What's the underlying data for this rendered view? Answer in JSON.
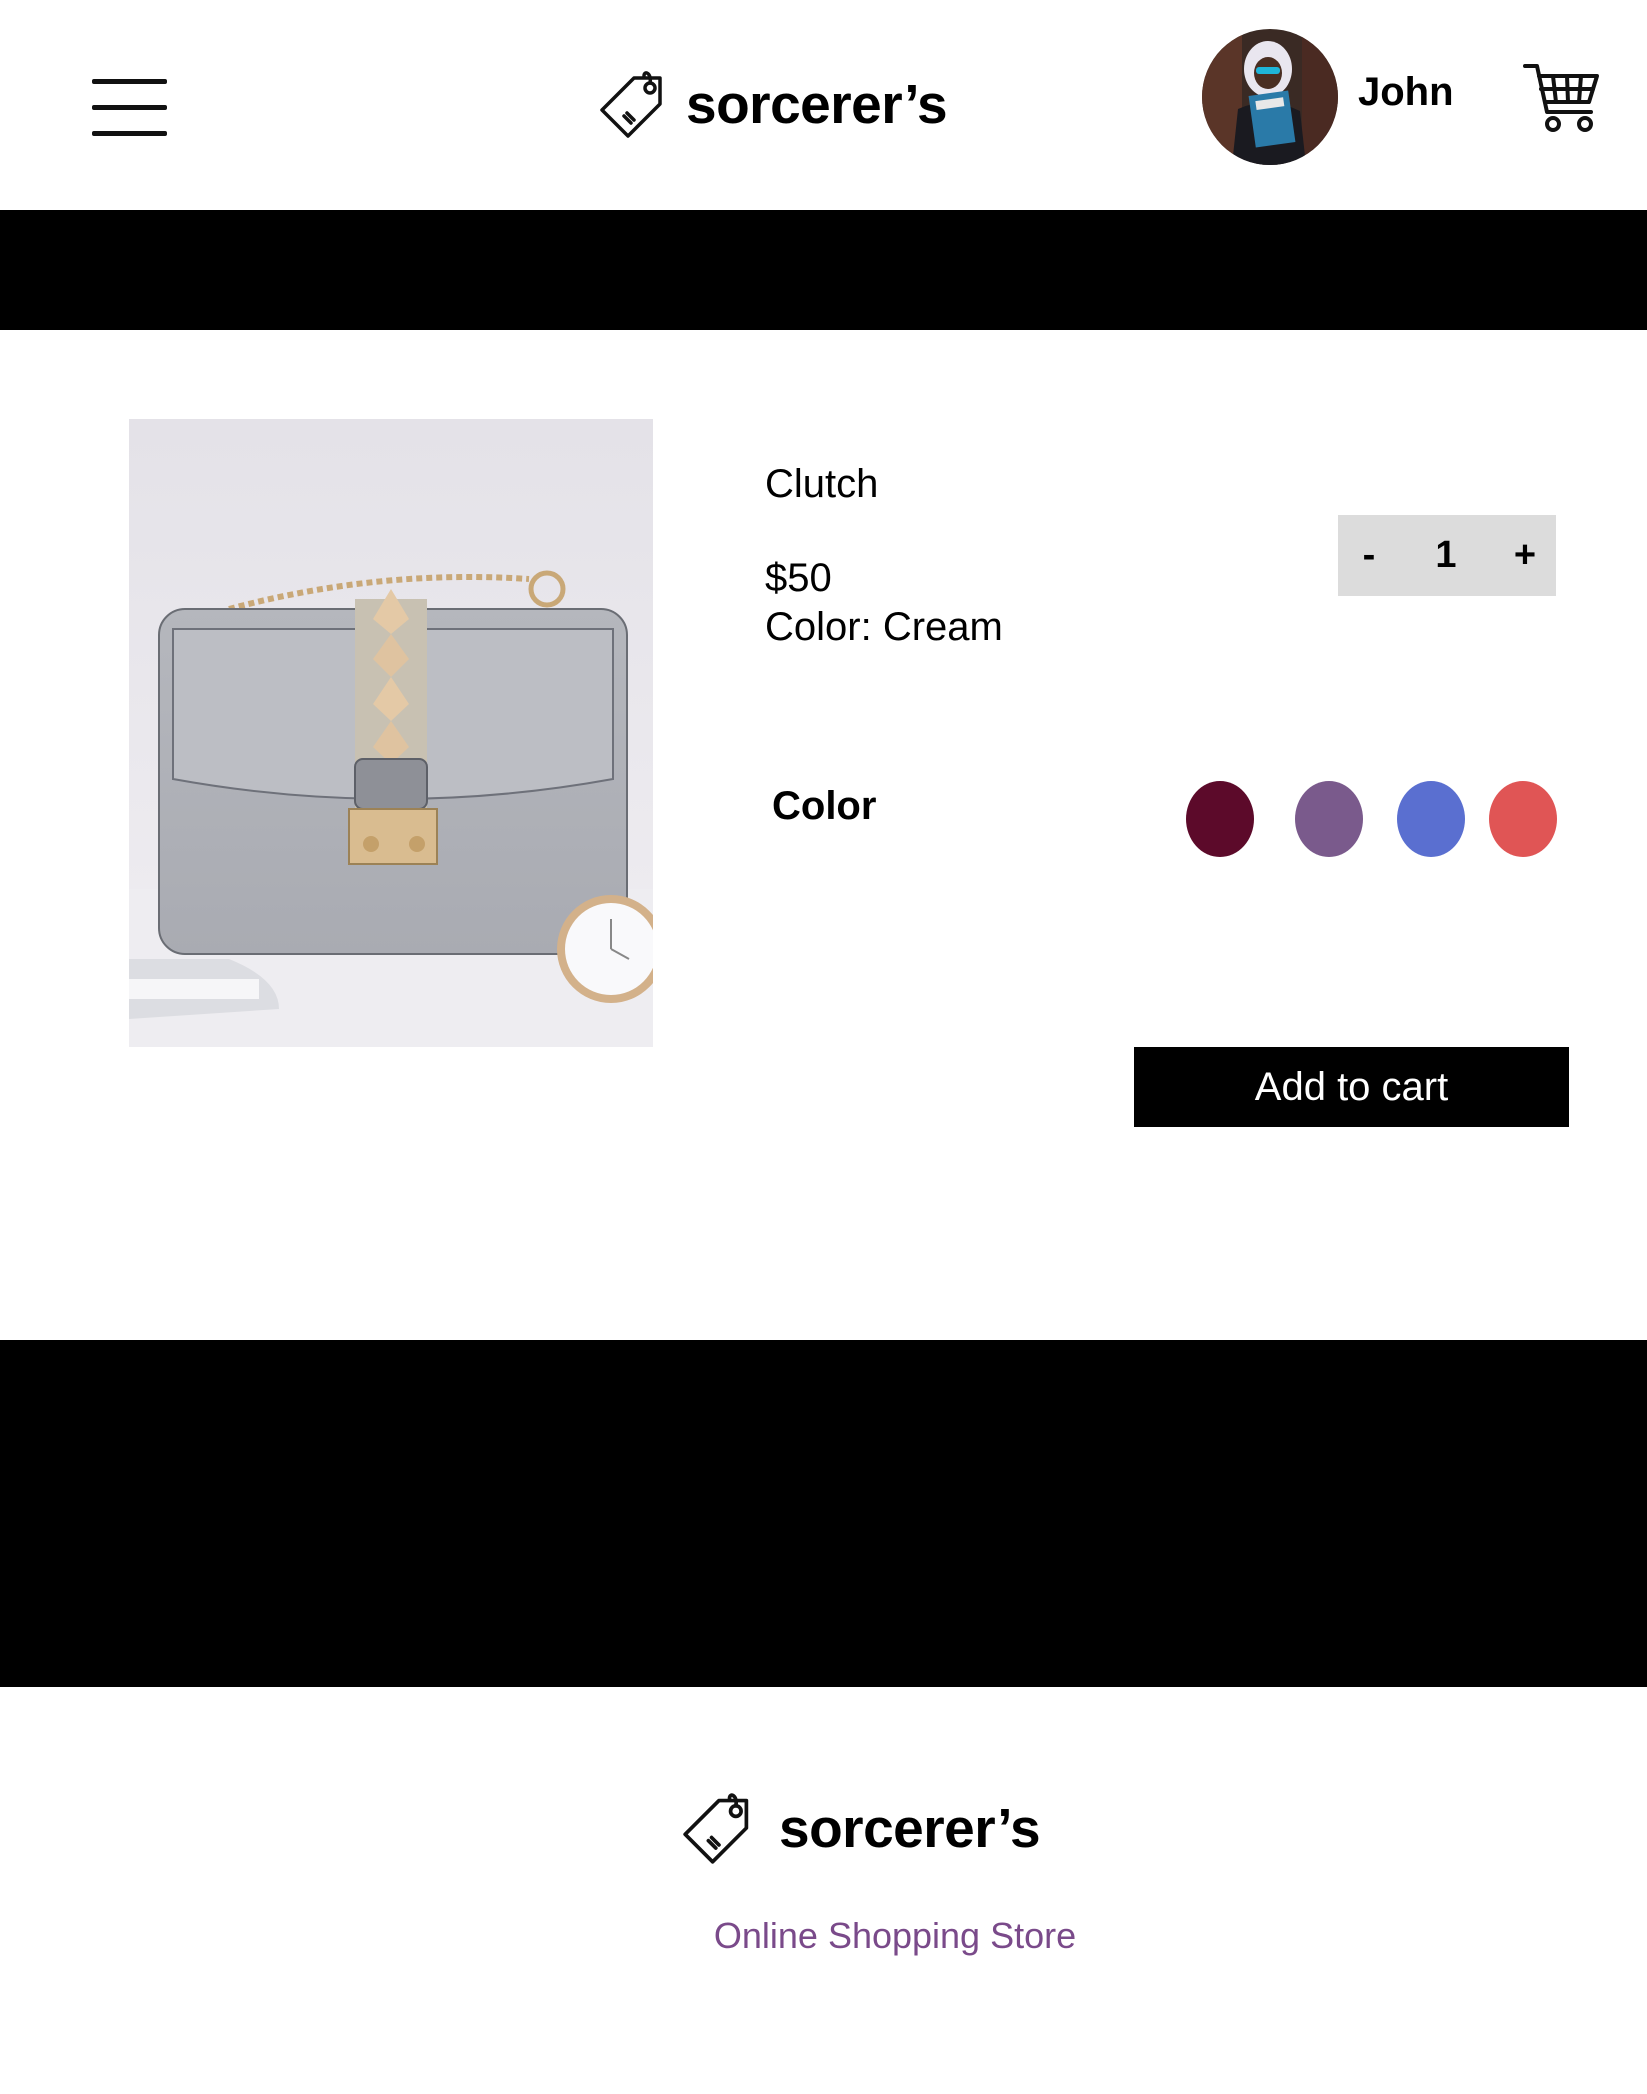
{
  "header": {
    "logo_text": "sorcerer’s",
    "username": "John"
  },
  "product": {
    "name": "Clutch",
    "price": "$50",
    "color_text": "Color: Cream",
    "quantity": "1",
    "minus_label": "-",
    "plus_label": "+",
    "color_section_label": "Color",
    "swatches": [
      "#5c0a2a",
      "#7a5a8c",
      "#5a6fd0",
      "#e05555"
    ],
    "add_to_cart_label": "Add to cart"
  },
  "footer": {
    "logo_text": "sorcerer’s",
    "tagline": "Online Shopping Store"
  },
  "colors": {
    "bar": "#000000",
    "tagline": "#7a4a8a",
    "quantity_bg": "#dcdcdc"
  }
}
